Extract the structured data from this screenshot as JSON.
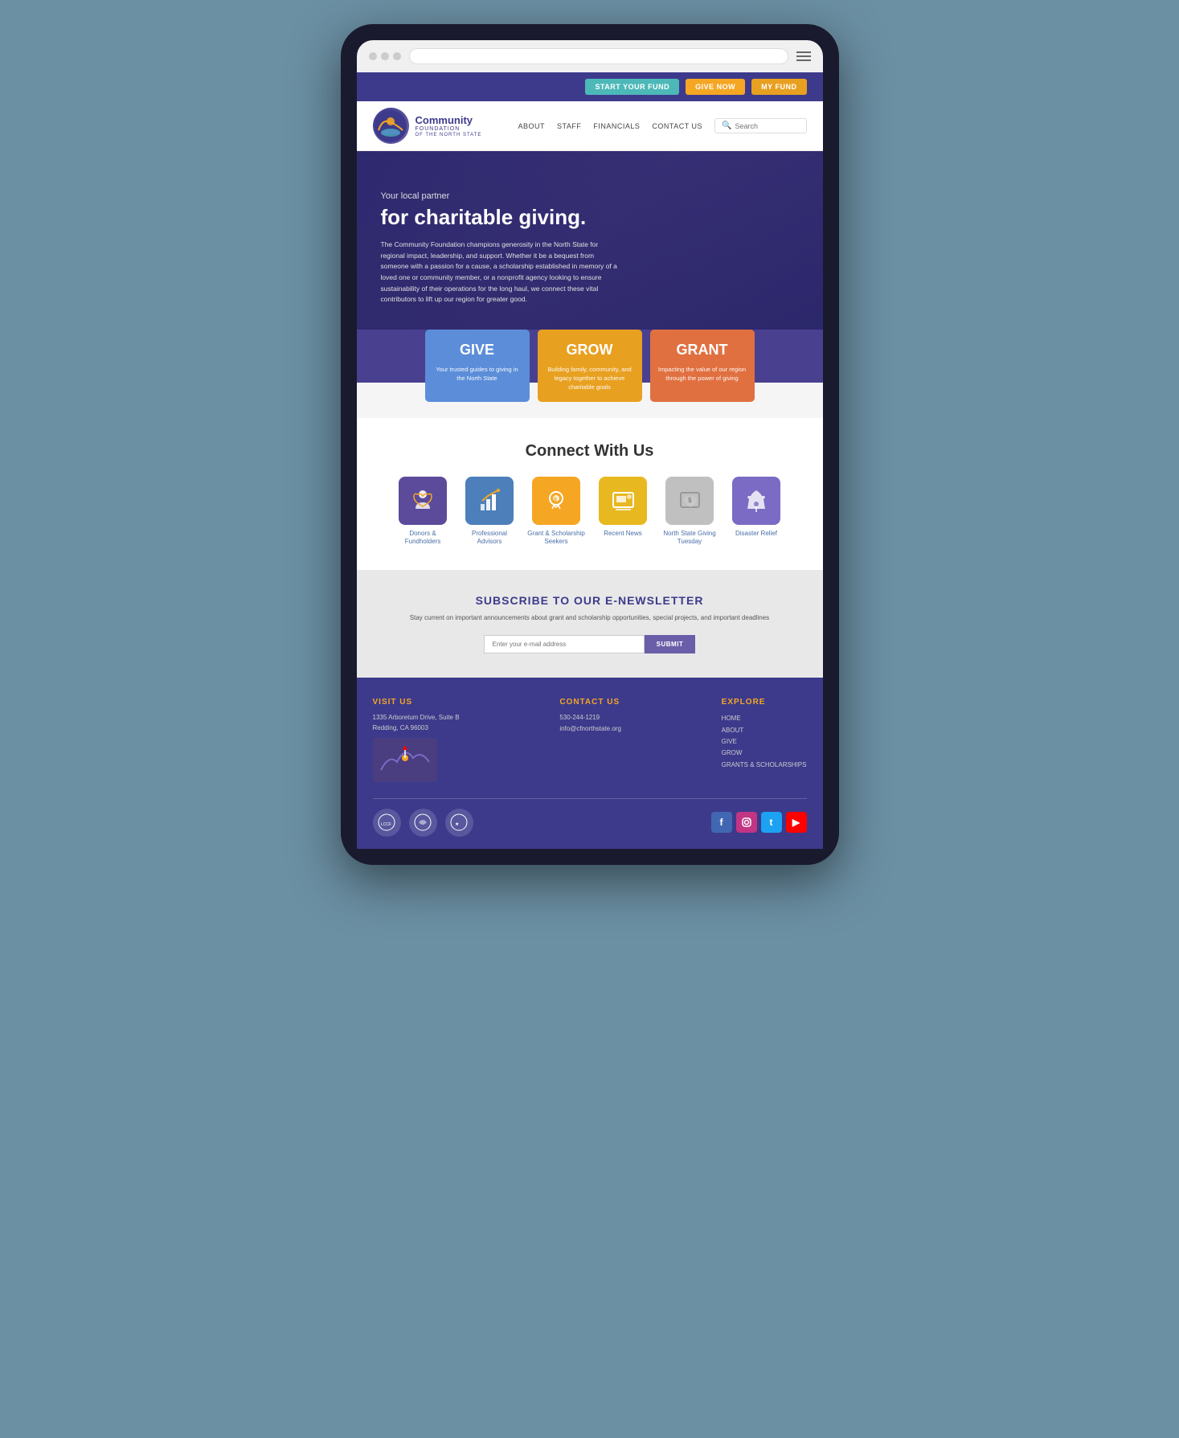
{
  "device": {
    "title": "Community Foundation of the North State"
  },
  "header": {
    "buttons": {
      "start_fund": "START YOUR FUND",
      "give_now": "GIVE NOW",
      "my_fund": "MY FUND"
    }
  },
  "nav": {
    "logo_main": "Community",
    "logo_foundation": "FOUNDATION",
    "logo_sub": "OF THE NORTH STATE",
    "links": [
      "ABOUT",
      "STAFF",
      "FINANCIALS",
      "CONTACT US"
    ],
    "search_placeholder": "Search"
  },
  "hero": {
    "subtitle": "Your local partner",
    "title": "for charitable giving.",
    "description": "The Community Foundation champions generosity in the North State for regional impact, leadership, and support. Whether it be a bequest from someone with a passion for a cause, a scholarship established in memory of a loved one or community member, or a nonprofit agency looking to ensure sustainability of their operations for the long haul, we connect these vital contributors to lift up our region for greater good."
  },
  "ggg": {
    "give": {
      "title": "GIVE",
      "desc": "Your trusted guides to giving in the North State"
    },
    "grow": {
      "title": "GROW",
      "desc": "Building family, community, and legacy together to achieve charitable goals"
    },
    "grant": {
      "title": "GRANT",
      "desc": "Impacting the value of our region through the power of giving"
    }
  },
  "connect": {
    "title": "Connect With Us",
    "items": [
      {
        "label": "Donors & Fundholders",
        "icon": "hand-heart"
      },
      {
        "label": "Professional Advisors",
        "icon": "chart-up"
      },
      {
        "label": "Grant & Scholarship Seekers",
        "icon": "lightbulb"
      },
      {
        "label": "Recent News",
        "icon": "monitor"
      },
      {
        "label": "North State Giving Tuesday",
        "icon": "dollar-bill"
      },
      {
        "label": "Disaster Relief",
        "icon": "parachute"
      }
    ]
  },
  "newsletter": {
    "title": "SUBSCRIBE TO OUR E-NEWSLETTER",
    "desc": "Stay current on important announcements about grant and scholarship opportunities, special projects, and important deadlines",
    "input_placeholder": "Enter your e-mail address",
    "button_label": "SUBMIT"
  },
  "footer": {
    "visit": {
      "heading": "VISIT US",
      "address1": "1335 Arboretum Drive, Suite B",
      "address2": "Redding, CA 96003"
    },
    "contact": {
      "heading": "CONTACT US",
      "phone": "530-244-1219",
      "email": "info@cfnorthstate.org"
    },
    "explore": {
      "heading": "EXPLORE",
      "links": [
        "HOME",
        "ABOUT",
        "GIVE",
        "GROW",
        "GRANTS & SCHOLARSHIPS"
      ]
    },
    "social": {
      "facebook": "f",
      "instagram": "📷",
      "twitter": "t",
      "youtube": "▶"
    }
  }
}
